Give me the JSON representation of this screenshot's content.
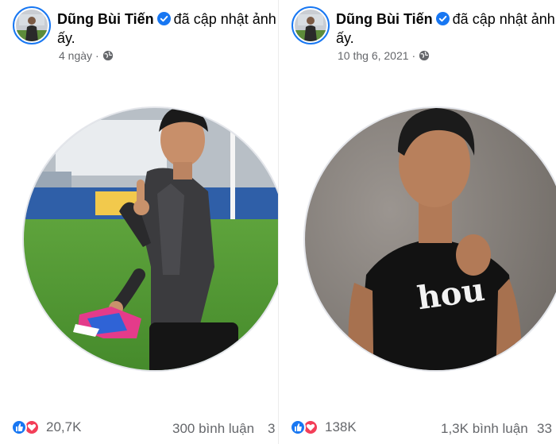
{
  "posts": [
    {
      "author": "Dũng Bùi Tiến",
      "action": "đã cập nhật ảnh đại diện của anh ấy.",
      "time": "4 ngày",
      "reactions_count": "20,7K",
      "comments": "300 bình luận",
      "shares": "3"
    },
    {
      "author": "Dũng Bùi Tiến",
      "action": "đã cập nhật ảnh đại diện của anh ấy.",
      "time": "10 thg 6, 2021",
      "reactions_count": "138K",
      "comments": "1,3K bình luận",
      "shares": "33"
    }
  ],
  "icons": {
    "verified": "verified-badge-icon",
    "privacy": "globe-icon",
    "like": "like-reaction-icon",
    "love": "love-reaction-icon"
  },
  "colors": {
    "accent": "#1877f2",
    "love": "#f33e58",
    "muted_text": "#65676b"
  }
}
